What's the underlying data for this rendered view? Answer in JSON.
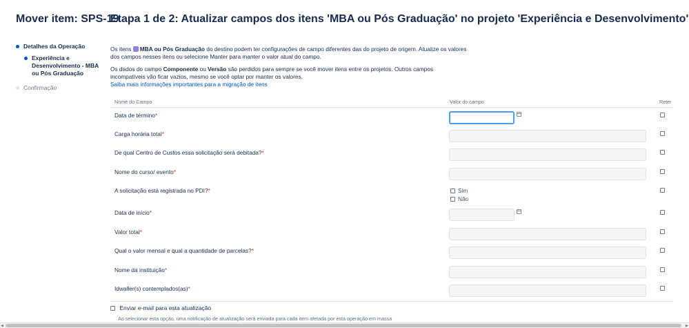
{
  "page_title": "Mover item: SPS-19",
  "steps": [
    {
      "label": "Detalhes da Operação"
    },
    {
      "label": "Experiência e Desenvolvimento - MBA ou Pós Graduação"
    },
    {
      "label": "Confirmação"
    }
  ],
  "main_title": "Etapa 1 de 2: Atualizar campos dos itens 'MBA ou Pós Graduação' no projeto 'Experiência e Desenvolvimento'",
  "intro": {
    "pre": "Os itens",
    "issue_type": "MBA ou Pós Graduação",
    "post": "do destino podem ter configurações de campo diferentes das do projeto de origem. Atualize os valores dos campos nesses itens ou selecione Manter para manter o valor atual do campo."
  },
  "lost_data": {
    "pre": "Os dados do campo",
    "field1": "Componente",
    "mid": "ou",
    "field2": "Versão",
    "post": "são perdidos para sempre se você mover itens entre os projetos. Outros campos incompatíveis vão ficar vazios, mesmo se você optar por manter os valores."
  },
  "learn_more_link": "Saiba mais informações importantes para a migração de itens",
  "table": {
    "col_name": "Nome do Campo",
    "col_value": "Valor do campo",
    "col_retain": "Reter",
    "rows": [
      {
        "label": "Data de término",
        "type": "date"
      },
      {
        "label": "Carga horária total",
        "type": "text"
      },
      {
        "label": "De qual Centro de Custos essa solicitação será debitada?",
        "type": "text"
      },
      {
        "label": "Nome do curso/ evento",
        "type": "text"
      },
      {
        "label": "A solicitação está registrada no PDI?",
        "type": "radio",
        "options": [
          "Sim",
          "Não"
        ]
      },
      {
        "label": "Data de início",
        "type": "date"
      },
      {
        "label": "Valor total",
        "type": "text"
      },
      {
        "label": "Qual o valor mensal e qual a quantidade de parcelas?",
        "type": "text"
      },
      {
        "label": "Nome da instituição",
        "type": "text"
      },
      {
        "label": "Idwaller(s) contemplados(as)",
        "type": "text"
      }
    ]
  },
  "required_mark": "*",
  "email": {
    "label": "Enviar e-mail para esta atualização",
    "description": "Ao selecionar esta opção, uma notificação de atualização será enviada para cada item afetada por esta operação em massa"
  },
  "colors": {
    "primary": "#0052cc",
    "required": "#de350b",
    "focus": "#4c9aff",
    "issue_type_icon": "#8f7ee7"
  },
  "icons": [
    "calendar-icon",
    "issue-type-icon"
  ]
}
